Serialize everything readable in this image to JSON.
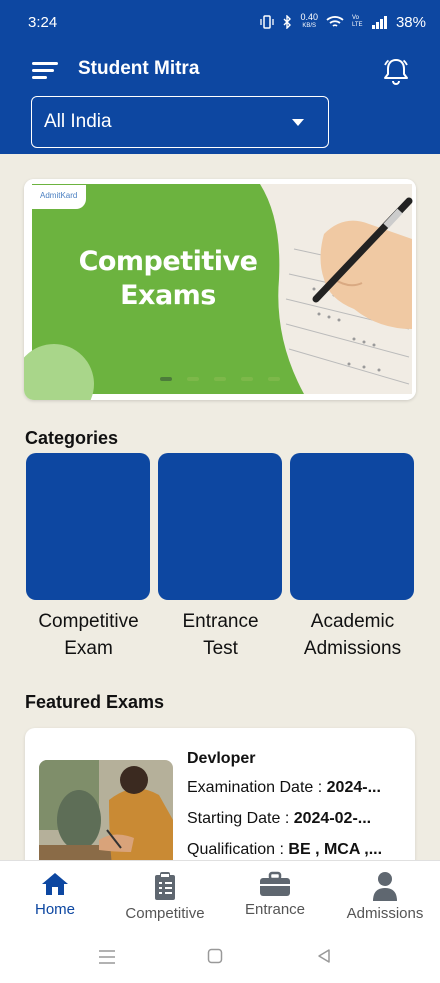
{
  "status": {
    "time": "3:24",
    "speed_value": "0.40",
    "speed_unit": "KB/S",
    "network": "Vo LTE",
    "battery": "38%"
  },
  "appbar": {
    "title": "Student Mitra",
    "region_value": "All India"
  },
  "banner": {
    "brand": "AdmitKard",
    "title": "Competitive Exams",
    "slide_count": 5,
    "active_slide": 1
  },
  "categories": {
    "title": "Categories",
    "items": [
      {
        "line1": "Competitive",
        "line2": "Exam"
      },
      {
        "line1": "Entrance",
        "line2": "Test"
      },
      {
        "line1": "Academic",
        "line2": "Admissions"
      }
    ]
  },
  "featured": {
    "title": "Featured Exams",
    "exam": {
      "name": "Devloper",
      "exam_date_label": "Examination Date :",
      "exam_date_value": "2024-...",
      "start_date_label": "Starting Date :",
      "start_date_value": "2024-02-...",
      "qualification_label": "Qualification :",
      "qualification_value": "BE , MCA ,..."
    }
  },
  "bottom_nav": {
    "items": [
      {
        "label": "Home",
        "icon": "home-icon",
        "active": true
      },
      {
        "label": "Competitive",
        "icon": "clipboard-icon",
        "active": false
      },
      {
        "label": "Entrance",
        "icon": "briefcase-icon",
        "active": false
      },
      {
        "label": "Admissions",
        "icon": "person-icon",
        "active": false
      }
    ]
  },
  "colors": {
    "primary": "#0d47a1",
    "background": "#efece2",
    "banner_green": "#6cb33f"
  }
}
